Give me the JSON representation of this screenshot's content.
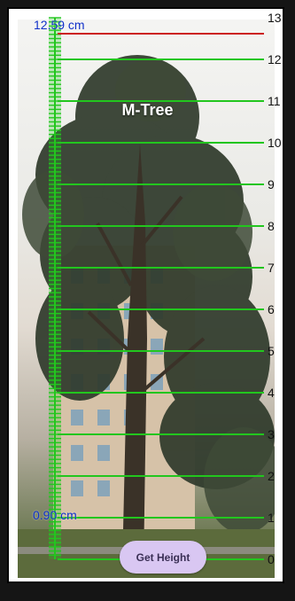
{
  "app": {
    "title": "M-Tree"
  },
  "readings": {
    "top": "12.59 cm",
    "bottom": "0.90 cm"
  },
  "scale": {
    "labels": [
      "0",
      "1",
      "2",
      "3",
      "4",
      "5",
      "6",
      "7",
      "8",
      "9",
      "10",
      "11",
      "12",
      "13"
    ]
  },
  "actions": {
    "get_height_label": "Get Height"
  },
  "colors": {
    "marker_line": "#cc2020",
    "ruler": "#22c61e",
    "reading_text": "#1030c8",
    "button_bg": "#d9c7f2"
  }
}
